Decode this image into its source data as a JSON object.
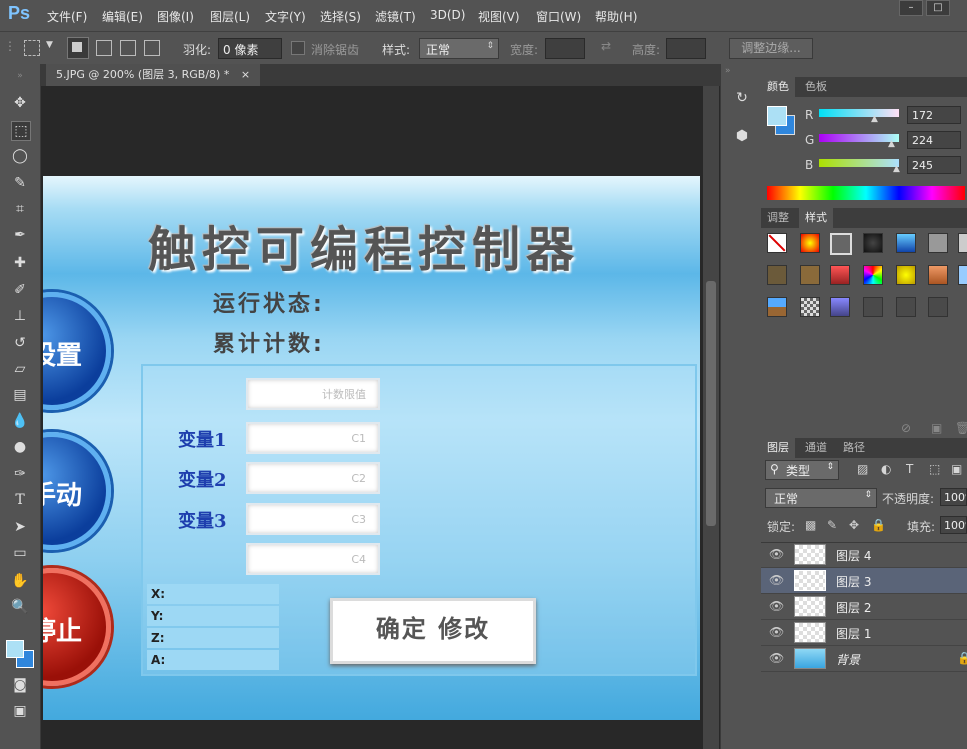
{
  "app": {
    "logo": "Ps"
  },
  "menu": [
    "文件(F)",
    "编辑(E)",
    "图像(I)",
    "图层(L)",
    "文字(Y)",
    "选择(S)",
    "滤镜(T)",
    "3D(D)",
    "视图(V)",
    "窗口(W)",
    "帮助(H)"
  ],
  "window_controls": {
    "minimize": "–",
    "maximize": "□",
    "close": "✕"
  },
  "options": {
    "feather_label": "羽化:",
    "feather_value": "0 像素",
    "antialias_label": "消除锯齿",
    "style_label": "样式:",
    "style_value": "正常",
    "width_label": "宽度:",
    "height_label": "高度:",
    "refine_button": "调整边缘..."
  },
  "document_tab": {
    "title": "5.JPG @ 200% (图层 3, RGB/8) *",
    "close": "×"
  },
  "image": {
    "title": "触控可编程控制器",
    "status_label": "运行状态:",
    "count_label": "累计计数:",
    "buttons": [
      "设置",
      "手动",
      "停止"
    ],
    "fields": [
      "计数限值",
      "C1",
      "C2",
      "C3",
      "C4"
    ],
    "var_labels": [
      "变量1",
      "变量2",
      "变量3"
    ],
    "coords": [
      "X:",
      "Y:",
      "Z:",
      "A:"
    ],
    "confirm": "确定 修改"
  },
  "color_panel": {
    "tabs": [
      "颜色",
      "色板"
    ],
    "channels": [
      {
        "label": "R",
        "value": "172"
      },
      {
        "label": "G",
        "value": "224"
      },
      {
        "label": "B",
        "value": "245"
      }
    ],
    "foreground": "#ace0f5",
    "background": "#2f86dc"
  },
  "styles_panel": {
    "tabs": [
      "调整",
      "样式"
    ]
  },
  "layers_panel": {
    "tabs": [
      "图层",
      "通道",
      "路径"
    ],
    "filter_kind": "类型",
    "blend_mode": "正常",
    "opacity_label": "不透明度:",
    "opacity_value": "100%",
    "lock_label": "锁定:",
    "fill_label": "填充:",
    "fill_value": "100%",
    "layers": [
      {
        "name": "图层 4",
        "selected": false
      },
      {
        "name": "图层 3",
        "selected": true
      },
      {
        "name": "图层 2",
        "selected": false
      },
      {
        "name": "图层 1",
        "selected": false
      },
      {
        "name": "背景",
        "selected": false
      }
    ]
  }
}
